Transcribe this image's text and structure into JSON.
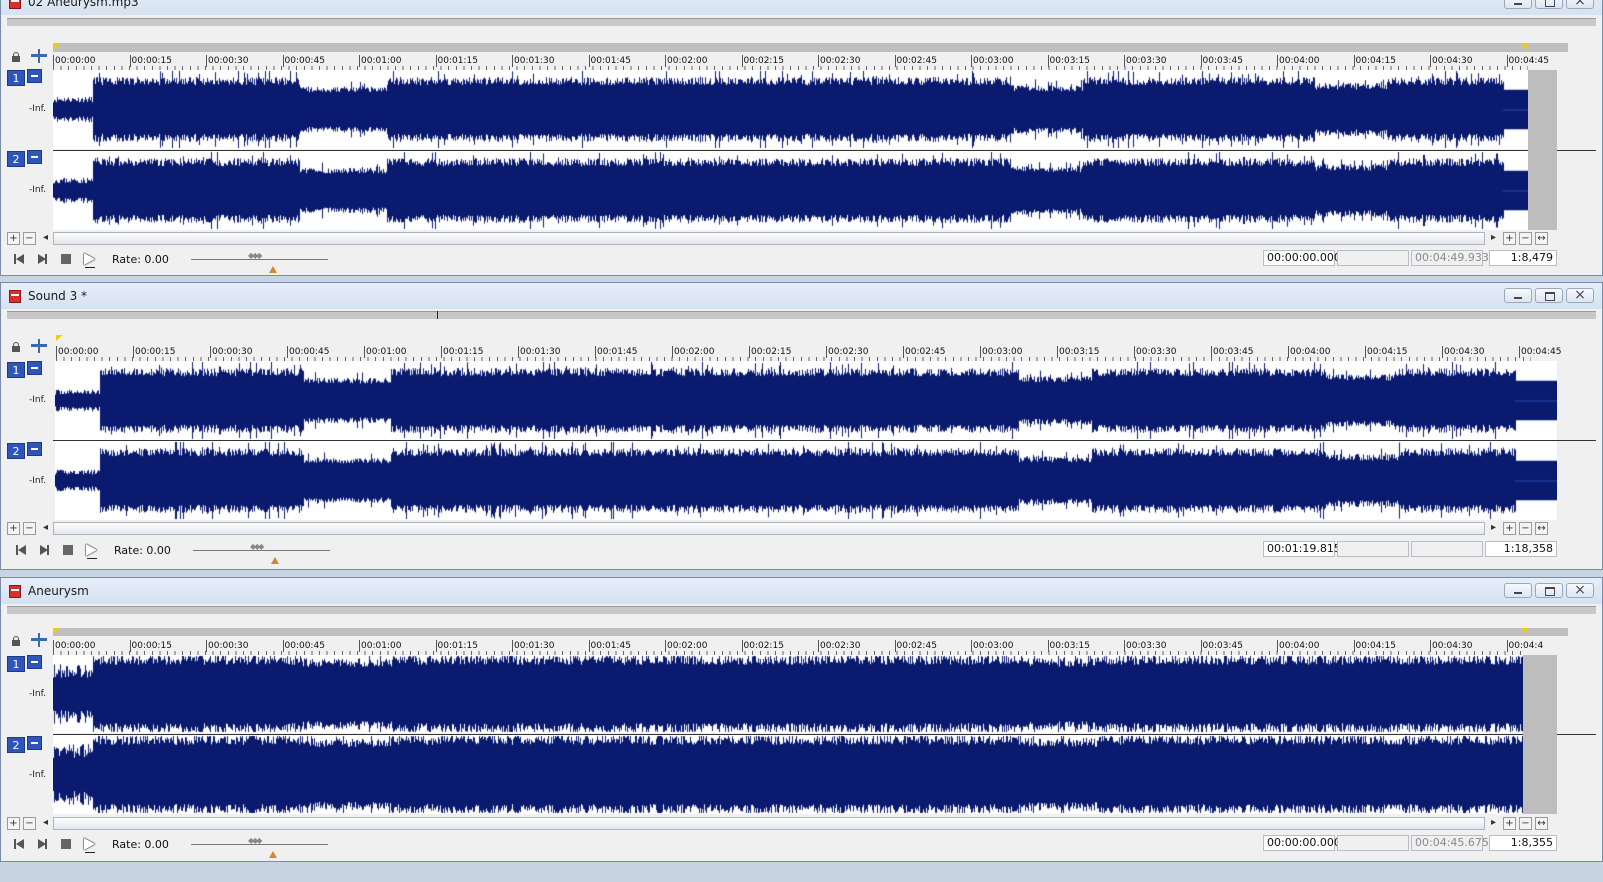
{
  "rate_label": "Rate: 0.00",
  "channel_level": "-Inf.",
  "windows": [
    {
      "title": "02 Aneurysm.mp3",
      "ruler": [
        "00:00:00",
        "00:00:15",
        "00:00:30",
        "00:00:45",
        "00:01:00",
        "00:01:15",
        "00:01:30",
        "00:01:45",
        "00:02:00",
        "00:02:15",
        "00:02:30",
        "00:02:45",
        "00:03:00",
        "00:03:15",
        "00:03:30",
        "00:03:45",
        "00:04:00",
        "00:04:15",
        "00:04:30",
        "00:04:45"
      ],
      "channels": [
        "1",
        "2"
      ],
      "selection_start": "00:00:00.000",
      "selection_end": "",
      "selection_length": "00:04:49.933",
      "zoom": "1:8,479"
    },
    {
      "title": "Sound 3 *",
      "ruler": [
        "00:00:00",
        "00:00:15",
        "00:00:30",
        "00:00:45",
        "00:01:00",
        "00:01:15",
        "00:01:30",
        "00:01:45",
        "00:02:00",
        "00:02:15",
        "00:02:30",
        "00:02:45",
        "00:03:00",
        "00:03:15",
        "00:03:30",
        "00:03:45",
        "00:04:00",
        "00:04:15",
        "00:04:30",
        "00:04:45"
      ],
      "channels": [
        "1",
        "2"
      ],
      "selection_start": "00:01:19.815",
      "selection_end": "",
      "selection_length": "",
      "zoom": "1:18,358"
    },
    {
      "title": "Aneurysm",
      "ruler": [
        "00:00:00",
        "00:00:15",
        "00:00:30",
        "00:00:45",
        "00:01:00",
        "00:01:15",
        "00:01:30",
        "00:01:45",
        "00:02:00",
        "00:02:15",
        "00:02:30",
        "00:02:45",
        "00:03:00",
        "00:03:15",
        "00:03:30",
        "00:03:45",
        "00:04:00",
        "00:04:15",
        "00:04:30",
        "00:04:4"
      ],
      "channels": [
        "1",
        "2"
      ],
      "selection_start": "00:00:00.000",
      "selection_end": "",
      "selection_length": "00:04:45.675",
      "zoom": "1:8,355"
    }
  ],
  "colors": {
    "waveform": "#0a1a6e",
    "channel_button": "#2f55b8",
    "marker": "#f0d000",
    "title_bar": "#dbe5f2"
  },
  "icons": [
    "lock-icon",
    "snap-icon",
    "go-to-start-icon",
    "go-to-end-icon",
    "stop-icon",
    "play-icon",
    "minimize-icon",
    "maximize-icon",
    "close-icon",
    "zoom-in-icon",
    "zoom-out-icon",
    "scroll-left-icon",
    "scroll-right-icon"
  ]
}
